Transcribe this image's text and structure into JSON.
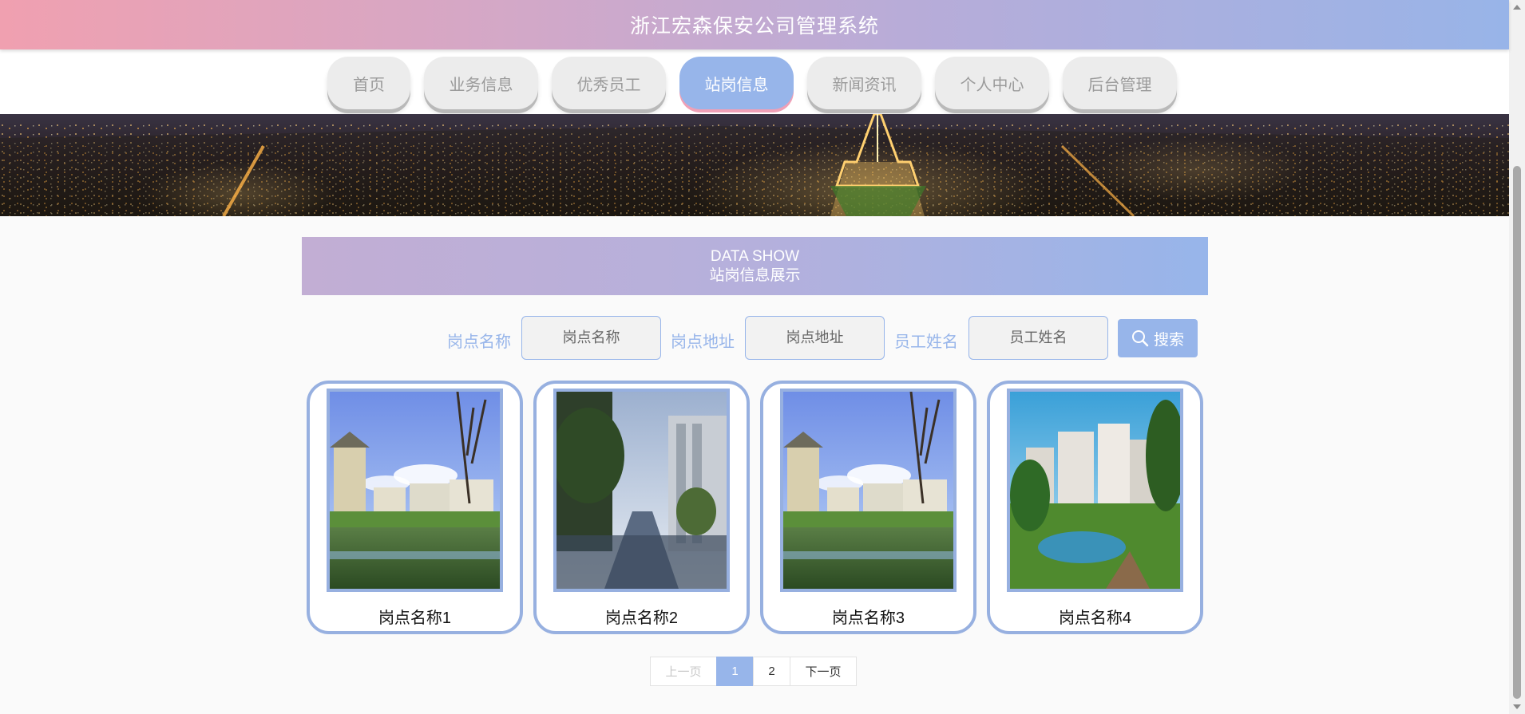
{
  "header": {
    "title": "浙江宏森保安公司管理系统"
  },
  "nav": {
    "items": [
      {
        "label": "首页",
        "active": false
      },
      {
        "label": "业务信息",
        "active": false
      },
      {
        "label": "优秀员工",
        "active": false
      },
      {
        "label": "站岗信息",
        "active": true
      },
      {
        "label": "新闻资讯",
        "active": false
      },
      {
        "label": "个人中心",
        "active": false
      },
      {
        "label": "后台管理",
        "active": false
      }
    ]
  },
  "section": {
    "en_title": "DATA SHOW",
    "cn_title": "站岗信息展示"
  },
  "search": {
    "post_name_label": "岗点名称",
    "post_name_placeholder": "岗点名称",
    "post_address_label": "岗点地址",
    "post_address_placeholder": "岗点地址",
    "staff_name_label": "员工姓名",
    "staff_name_placeholder": "员工姓名",
    "button_label": "搜索"
  },
  "cards": [
    {
      "name": "岗点名称1",
      "image": "residential-lake-photo"
    },
    {
      "name": "岗点名称2",
      "image": "residential-walkway-photo"
    },
    {
      "name": "岗点名称3",
      "image": "residential-lake-photo"
    },
    {
      "name": "岗点名称4",
      "image": "residential-garden-photo"
    }
  ],
  "pagination": {
    "prev": "上一页",
    "pages": [
      "1",
      "2"
    ],
    "current": "1",
    "next": "下一页"
  },
  "colors": {
    "accent": "#97b5ea",
    "pink": "#f0a0b0",
    "lavender": "#c2aed4",
    "card_border": "#97b0e0"
  }
}
